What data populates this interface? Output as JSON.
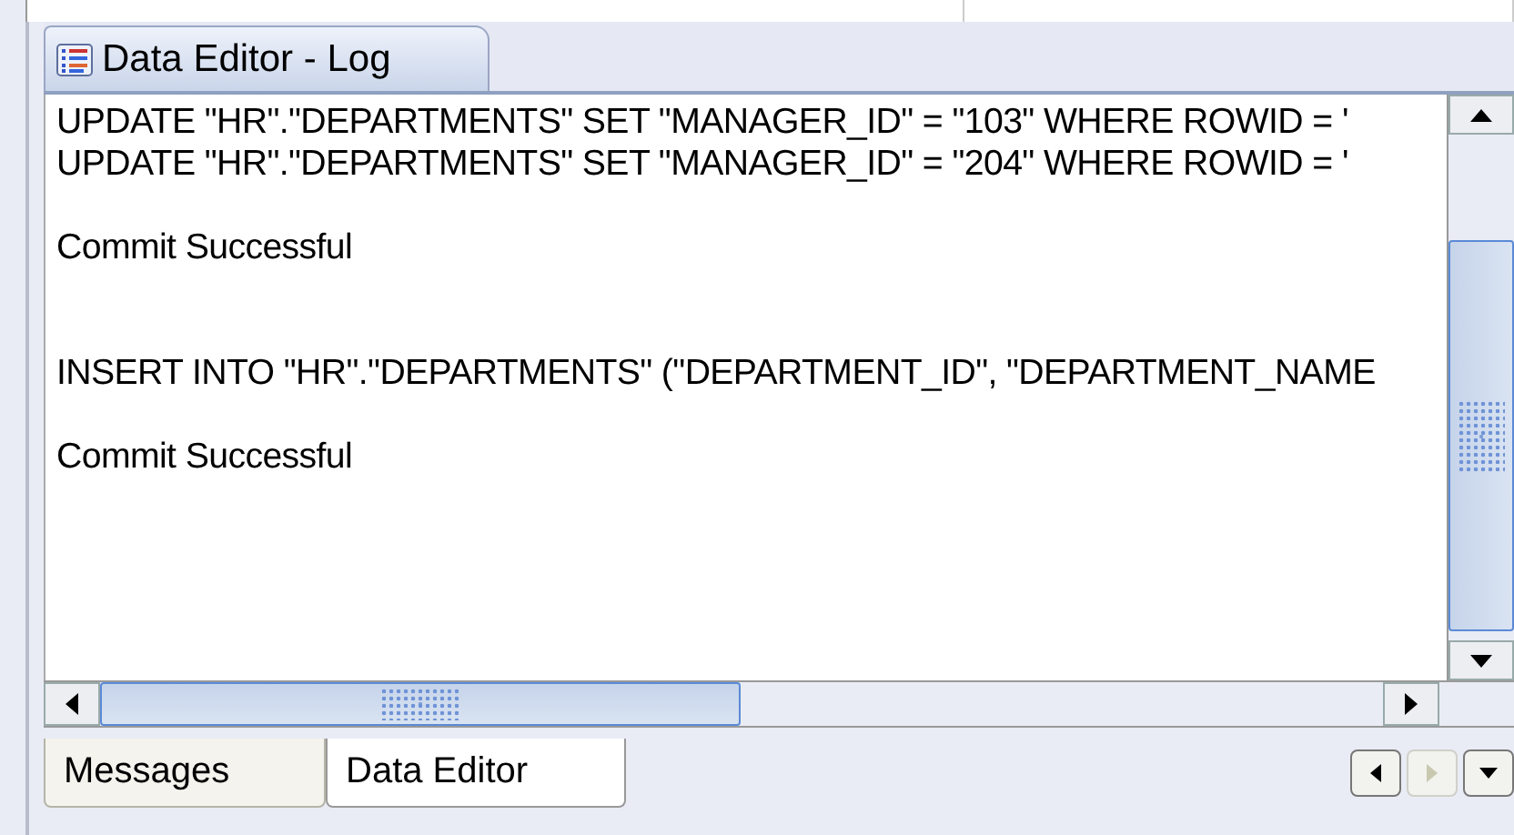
{
  "panel_tab": {
    "label": "Data Editor - Log",
    "selected": true
  },
  "log": [
    {
      "kind": "sql",
      "text": "UPDATE \"HR\".\"DEPARTMENTS\" SET \"MANAGER_ID\" = \"103\" WHERE ROWID = '"
    },
    {
      "kind": "sql",
      "text": "UPDATE \"HR\".\"DEPARTMENTS\" SET \"MANAGER_ID\" = \"204\" WHERE ROWID = '"
    },
    {
      "kind": "blank"
    },
    {
      "kind": "message",
      "text": "Commit Successful"
    },
    {
      "kind": "blank"
    },
    {
      "kind": "blank"
    },
    {
      "kind": "sql",
      "text": "INSERT INTO \"HR\".\"DEPARTMENTS\" (\"DEPARTMENT_ID\", \"DEPARTMENT_NAME"
    },
    {
      "kind": "blank"
    },
    {
      "kind": "message",
      "text": "Commit Successful"
    }
  ],
  "bottom_tabs": [
    {
      "label": "Messages",
      "selected": false
    },
    {
      "label": "Data Editor",
      "selected": true
    }
  ]
}
